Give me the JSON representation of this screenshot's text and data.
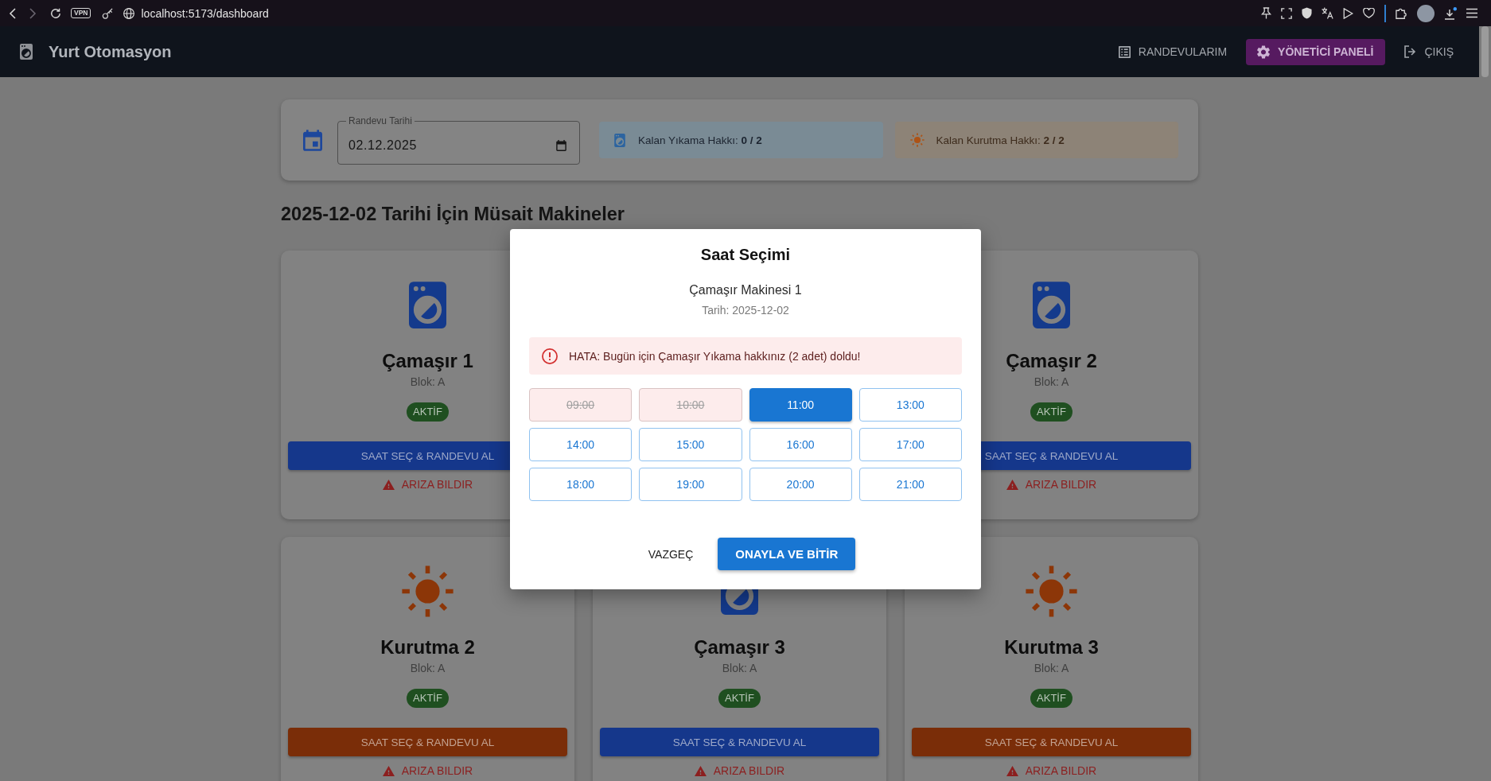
{
  "browser": {
    "vpn_label": "VPN",
    "url": "localhost:5173/dashboard"
  },
  "header": {
    "title": "Yurt Otomasyon",
    "nav": [
      {
        "kind": "appointments",
        "label": "RANDEVULARIM"
      },
      {
        "kind": "admin",
        "label": "YÖNETİCİ PANELİ"
      },
      {
        "kind": "logout",
        "label": "ÇIKIŞ"
      }
    ]
  },
  "filter": {
    "date_field": {
      "label": "Randevu Tarihi",
      "value": "02.12.2025"
    },
    "quotas": [
      {
        "kind": "wash",
        "text": "Kalan Yıkama Hakkı: **0 / 2**"
      },
      {
        "kind": "dry",
        "text": "Kalan Kurutma Hakkı: **2 / 2**"
      }
    ]
  },
  "section_title": "2025-12-02 Tarihi İçin Müsait Makineler",
  "machines": [
    {
      "kind": "wash",
      "name": "Çamaşır 1",
      "block": "Blok: A",
      "status": "AKTİF",
      "action": "SAAT SEÇ & RANDEVU AL",
      "report": "ARIZA BILDIR"
    },
    {
      "kind": "wash",
      "name": "Çamaşır 2",
      "block": "Blok: A",
      "status": "AKTİF",
      "action": "SAAT SEÇ & RANDEVU AL",
      "report": "ARIZA BILDIR"
    },
    {
      "kind": "dry",
      "name": "Kurutma 2",
      "block": "Blok: A",
      "status": "AKTİF",
      "action": "SAAT SEÇ & RANDEVU AL",
      "report": "ARIZA BILDIR"
    },
    {
      "kind": "wash",
      "name": "Çamaşır 3",
      "block": "Blok: A",
      "status": "AKTİF",
      "action": "SAAT SEÇ & RANDEVU AL",
      "report": "ARIZA BILDIR"
    },
    {
      "kind": "dry",
      "name": "Kurutma 3",
      "block": "Blok: A",
      "status": "AKTİF",
      "action": "SAAT SEÇ & RANDEVU AL",
      "report": "ARIZA BILDIR"
    }
  ],
  "dialog": {
    "title": "Saat Seçimi",
    "machine": "Çamaşır Makinesi 1",
    "date": "Tarih: 2025-12-02",
    "error": "HATA: Bugün için Çamaşır Yıkama hakkınız (2 adet) doldu!",
    "slots": [
      {
        "time": "09:00",
        "booked": true,
        "selected": false
      },
      {
        "time": "10:00",
        "booked": true,
        "selected": false
      },
      {
        "time": "11:00",
        "booked": false,
        "selected": true
      },
      {
        "time": "13:00",
        "booked": false,
        "selected": false
      },
      {
        "time": "14:00",
        "booked": false,
        "selected": false
      },
      {
        "time": "15:00",
        "booked": false,
        "selected": false
      },
      {
        "time": "16:00",
        "booked": false,
        "selected": false
      },
      {
        "time": "17:00",
        "booked": false,
        "selected": false
      },
      {
        "time": "18:00",
        "booked": false,
        "selected": false
      },
      {
        "time": "19:00",
        "booked": false,
        "selected": false
      },
      {
        "time": "20:00",
        "booked": false,
        "selected": false
      },
      {
        "time": "21:00",
        "booked": false,
        "selected": false
      }
    ],
    "buttons": [
      {
        "kind": "text",
        "label": "VAZGEÇ"
      },
      {
        "kind": "primary",
        "label": "ONAYLA VE BİTİR"
      }
    ]
  }
}
